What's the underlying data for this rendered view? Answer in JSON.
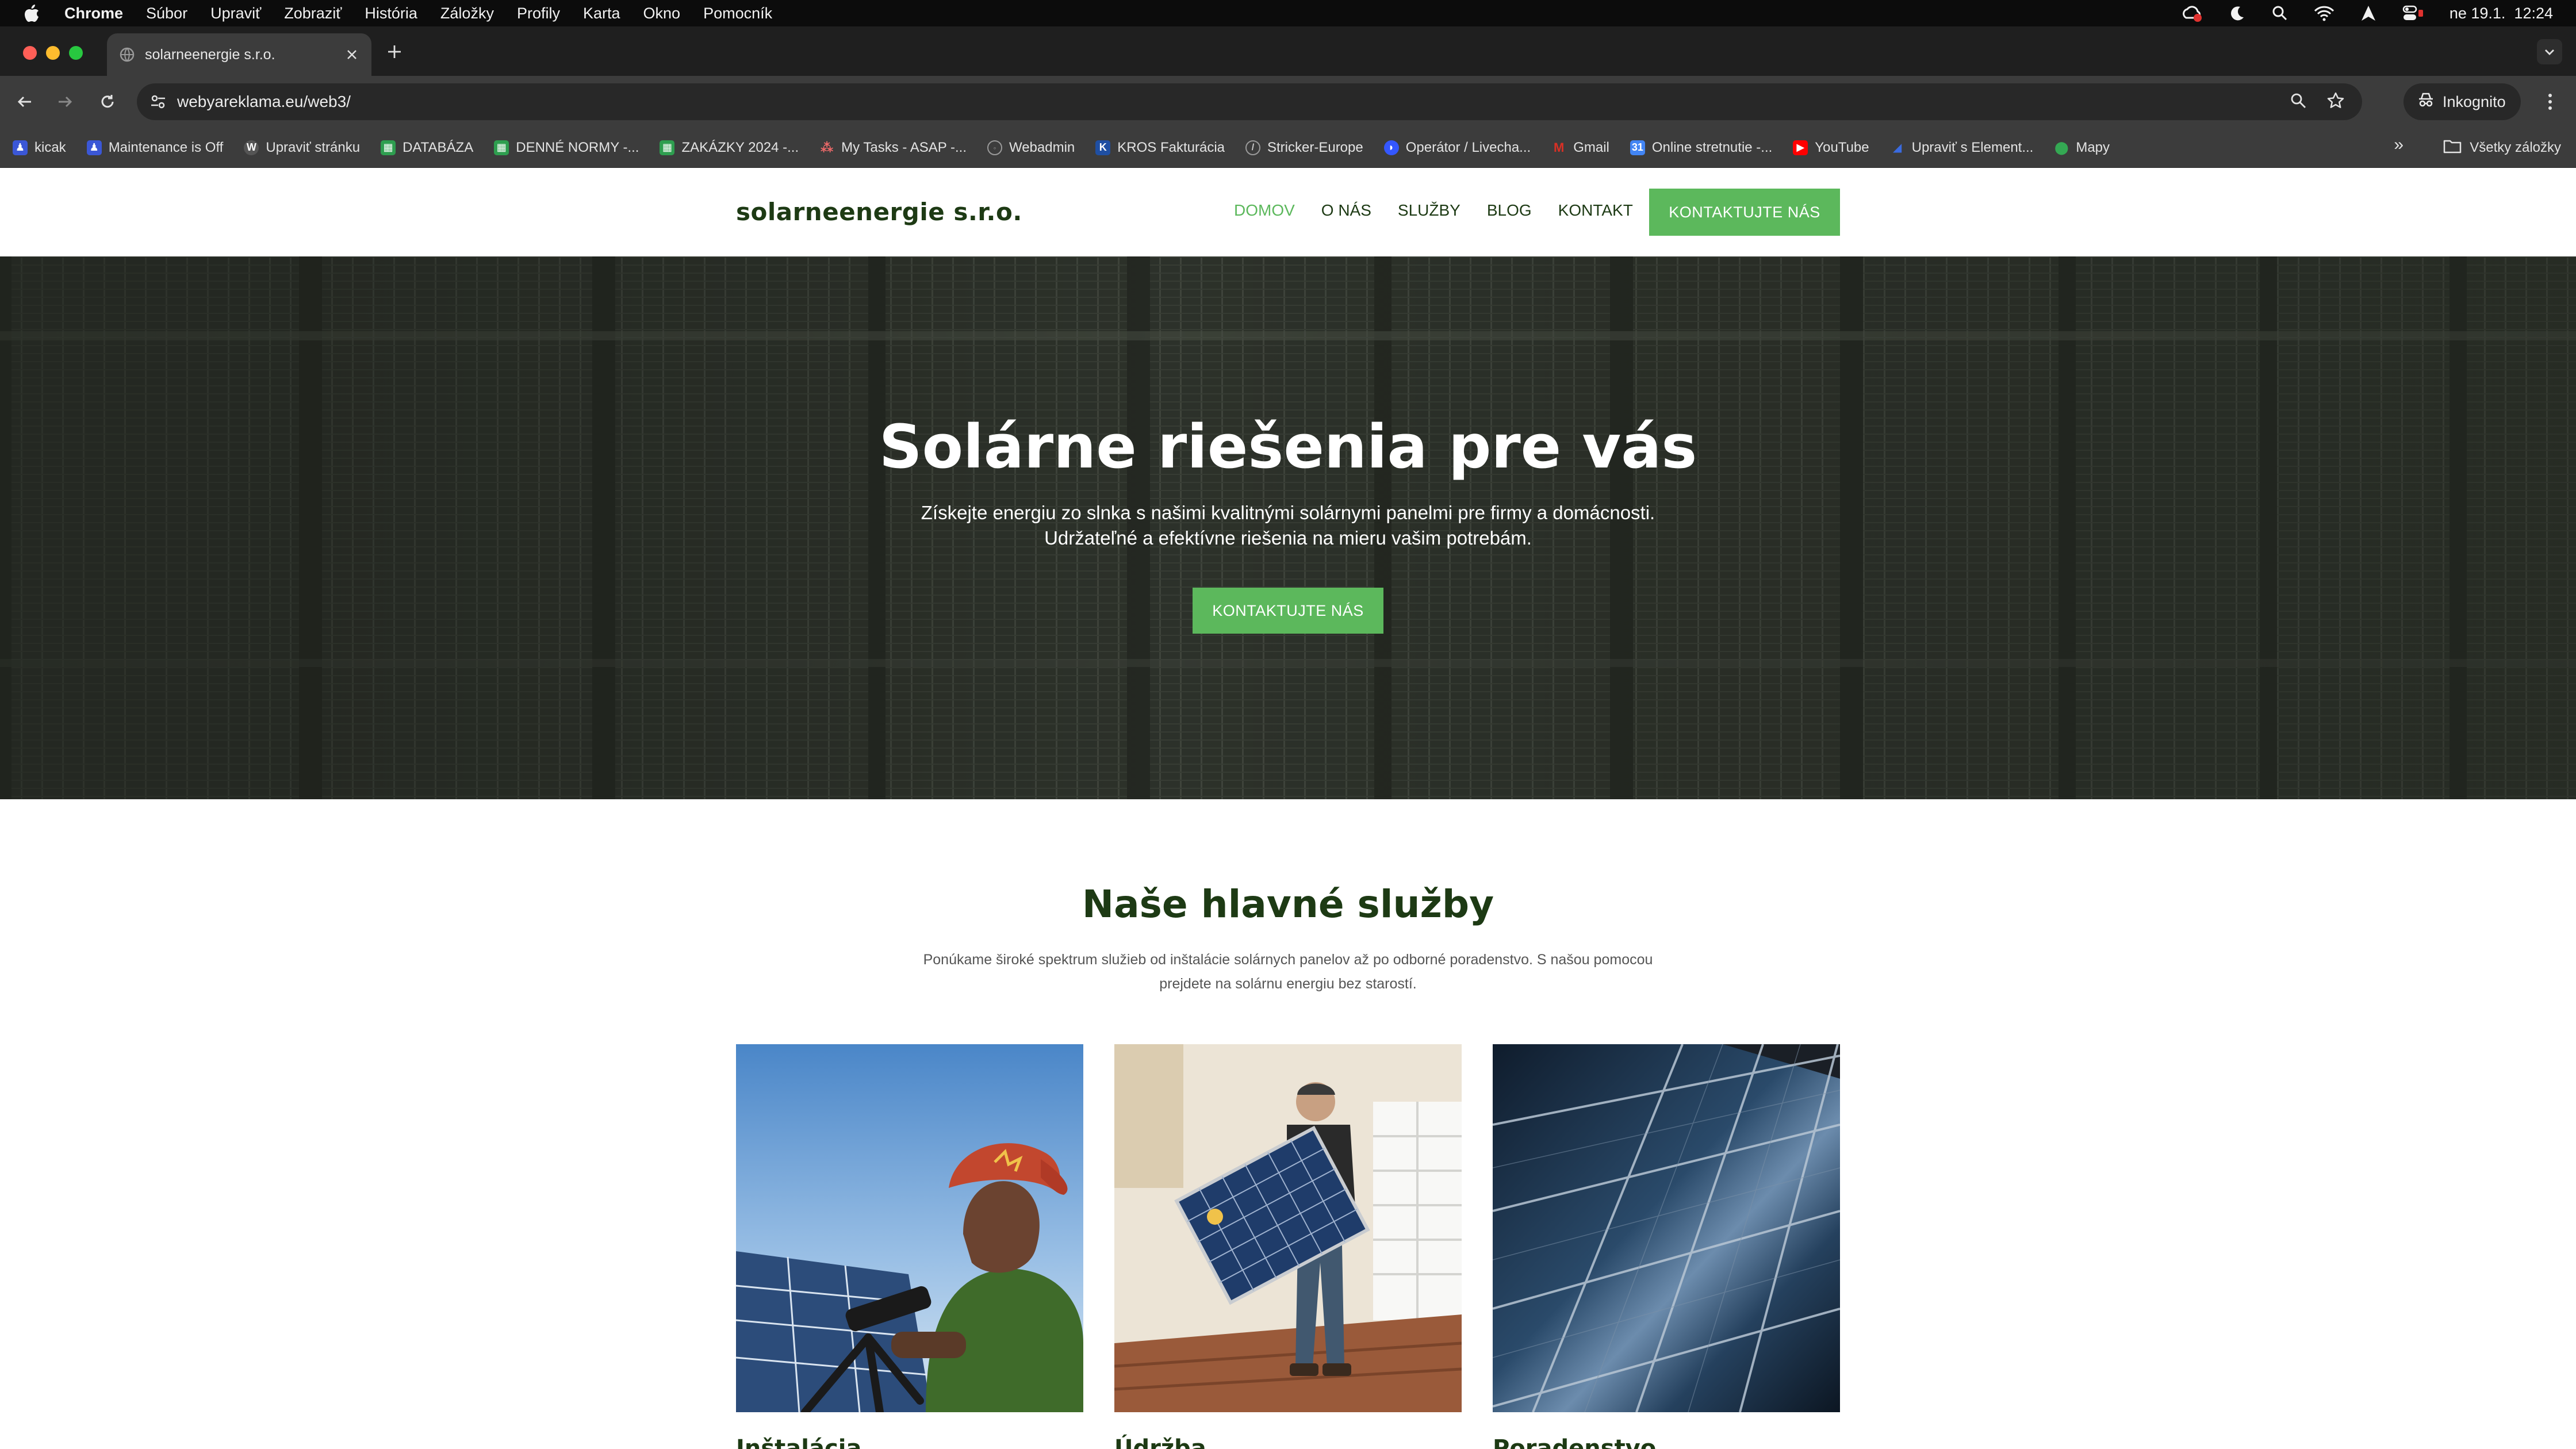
{
  "menubar": {
    "app": "Chrome",
    "items": [
      "Súbor",
      "Upraviť",
      "Zobraziť",
      "História",
      "Záložky",
      "Profily",
      "Karta",
      "Okno",
      "Pomocník"
    ],
    "datetime": "ne 19.1.  12:24"
  },
  "tab": {
    "title": "solarneenergie s.r.o."
  },
  "address": {
    "url": "webyareklama.eu/web3/"
  },
  "profile": {
    "label": "Inkognito"
  },
  "bookmarks": [
    {
      "label": "kicak",
      "icon": "person-icon",
      "color": "#3b57d6"
    },
    {
      "label": "Maintenance is Off",
      "icon": "person-icon",
      "color": "#3b57d6"
    },
    {
      "label": "Upraviť stránku",
      "icon": "wordpress-icon",
      "color": "#555555"
    },
    {
      "label": "DATABÁZA",
      "icon": "sheets-icon",
      "color": "#2e9e4f"
    },
    {
      "label": "DENNÉ NORMY -...",
      "icon": "sheets-icon",
      "color": "#2e9e4f"
    },
    {
      "label": "ZAKÁZKY 2024 -...",
      "icon": "sheets-icon",
      "color": "#2e9e4f"
    },
    {
      "label": "My Tasks - ASAP -...",
      "icon": "asana-icon",
      "color": "#f06a6a"
    },
    {
      "label": "Webadmin",
      "icon": "webadmin-icon",
      "color": "#6a6a6a"
    },
    {
      "label": "KROS Fakturácia",
      "icon": "kros-icon",
      "color": "#1f4fa3"
    },
    {
      "label": "Stricker-Europe",
      "icon": "stricker-icon",
      "color": "#6a6a6a"
    },
    {
      "label": "Operátor / Livecha...",
      "icon": "livechat-icon",
      "color": "#3457ff"
    },
    {
      "label": "Gmail",
      "icon": "gmail-icon",
      "color": "#d93025"
    },
    {
      "label": "Online stretnutie -...",
      "icon": "calendar-icon",
      "color": "#4285f4"
    },
    {
      "label": "YouTube",
      "icon": "youtube-icon",
      "color": "#ff0000"
    },
    {
      "label": "Upraviť s Element...",
      "icon": "elementor-icon",
      "color": "#1b3a8f"
    },
    {
      "label": "Mapy",
      "icon": "maps-icon",
      "color": "#34a853"
    }
  ],
  "bookmarks_more": "»",
  "all_bookmarks": "Všetky záložky",
  "site": {
    "logo": "solarneenergie s.r.o.",
    "nav": [
      "DOMOV",
      "O NÁS",
      "SLUŽBY",
      "BLOG",
      "KONTAKT"
    ],
    "header_cta": "KONTAKTUJTE NÁS",
    "hero": {
      "title": "Solárne riešenia pre vás",
      "subtitle": "Získejte energiu zo slnka s našimi kvalitnými solárnymi panelmi pre firmy a domácnosti. Udržateľné a efektívne riešenia na mieru vašim potrebám.",
      "cta": "KONTAKTUJTE NÁS"
    },
    "services": {
      "title": "Naše hlavné služby",
      "subtitle": "Ponúkame široké spektrum služieb od inštalácie solárnych panelov až po odborné poradenstvo. S našou pomocou prejdete na solárnu energiu bez starostí.",
      "cards": [
        {
          "title": "Inštalácia"
        },
        {
          "title": "Údržba"
        },
        {
          "title": "Poradenstvo"
        }
      ]
    }
  },
  "colors": {
    "brand_green": "#5cb85c",
    "brand_dark": "#1d3a14"
  }
}
